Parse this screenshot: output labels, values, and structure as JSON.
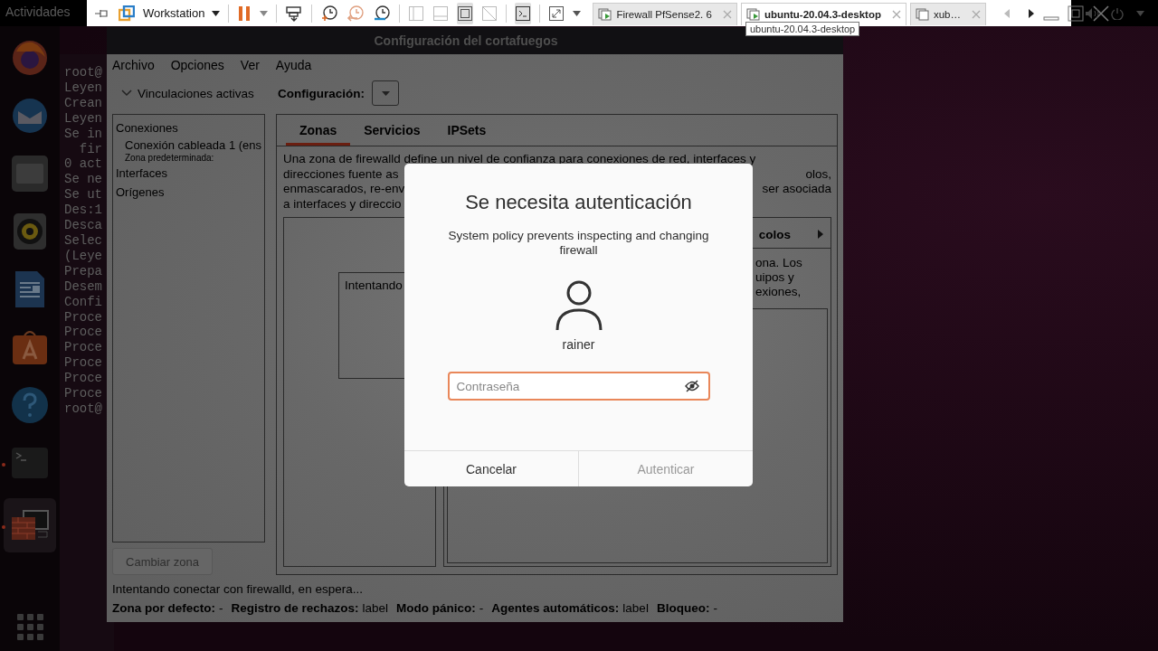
{
  "top_panel": {
    "activities": "Actividades"
  },
  "vmware": {
    "product": "Workstation",
    "paused": true,
    "fit_guest_pressed": true,
    "console_view_pressed": true,
    "tabs": [
      {
        "label": "Firewall PfSense2. 6",
        "selected": false
      },
      {
        "label": "ubuntu-20.04.3-desktop",
        "selected": true
      },
      {
        "label": "xub…",
        "selected": false
      }
    ],
    "tooltip": "ubuntu-20.04.3-desktop",
    "scroll_left_enabled": false,
    "scroll_right_enabled": true
  },
  "dock": {
    "items": [
      {
        "kind": "browser",
        "running": false,
        "focused": false
      },
      {
        "kind": "mail",
        "running": false,
        "focused": false
      },
      {
        "kind": "files",
        "running": false,
        "focused": false
      },
      {
        "kind": "music",
        "running": false,
        "focused": false
      },
      {
        "kind": "document",
        "running": false,
        "focused": false
      },
      {
        "kind": "store",
        "running": false,
        "focused": false
      },
      {
        "kind": "help",
        "running": false,
        "focused": false
      },
      {
        "kind": "terminal",
        "running": true,
        "focused": false
      },
      {
        "kind": "firewall",
        "running": true,
        "focused": true
      }
    ]
  },
  "terminal": {
    "lines": [
      "root@",
      "Leyen",
      "Crean",
      "Leyen",
      "Se in",
      "  fir",
      "0 act",
      "Se ne",
      "Se ut",
      "Des:1",
      "Desca",
      "Selec",
      "(Leye",
      "Prepa",
      "Desem",
      "Confi",
      "Proce",
      "Proce",
      "Proce",
      "Proce",
      "Proce",
      "Proce",
      "root@"
    ]
  },
  "window": {
    "title": "Configuración del cortafuegos"
  },
  "firewall": {
    "menu": [
      "Archivo",
      "Opciones",
      "Ver",
      "Ayuda"
    ],
    "bindings_toggle": {
      "label": "Vinculaciones activas",
      "expanded": true
    },
    "configuration_label": "Configuración:",
    "bindings": [
      {
        "kind": "heading",
        "text": "Conexiones"
      },
      {
        "kind": "connection",
        "text": "Conexión cableada 1 (ens"
      },
      {
        "kind": "note",
        "text": "Zona predeterminada:"
      },
      {
        "kind": "heading",
        "text": "Interfaces"
      },
      {
        "kind": "heading",
        "text": "Orígenes"
      }
    ],
    "change_zone_button": {
      "label": "Cambiar zona",
      "disabled": true
    },
    "tabs": [
      {
        "label": "Zonas",
        "selected": true
      },
      {
        "label": "Servicios",
        "selected": false
      },
      {
        "label": "IPSets",
        "selected": false
      }
    ],
    "description_lines": [
      {
        "left": "Una zona de firewalld define un nivel de confianza para conexiones de red, interfaces y"
      },
      {
        "left": "direcciones fuente as",
        "right": "olos,"
      },
      {
        "left": "enmascarados, re-env",
        "right": "ser asociada"
      },
      {
        "left": "a interfaces y direccio"
      }
    ],
    "zone_list_message": "Intentando",
    "right_pane_header": "colos",
    "right_pane_lines": [
      "ona. Los",
      "uipos y",
      "exiones,"
    ],
    "status_message": "Intentando conectar con firewalld, en espera...",
    "status_fields": [
      {
        "label": "Zona por defecto:",
        "value": "-"
      },
      {
        "label": "Registro de rechazos:",
        "value": "label"
      },
      {
        "label": "Modo pánico:",
        "value": "-"
      },
      {
        "label": "Agentes automáticos:",
        "value": "label"
      },
      {
        "label": "Bloqueo:",
        "value": "-"
      }
    ]
  },
  "auth_dialog": {
    "title": "Se necesita autenticación",
    "message": "System policy prevents inspecting and changing firewall",
    "user": "rainer",
    "password": {
      "placeholder": "Contraseña"
    },
    "buttons": [
      {
        "label": "Cancelar",
        "disabled": false
      },
      {
        "label": "Autenticar",
        "disabled": true
      }
    ]
  }
}
